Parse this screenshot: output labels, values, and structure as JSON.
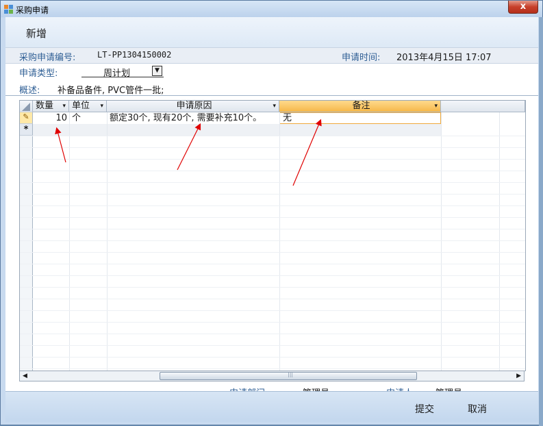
{
  "window": {
    "title": "采购申请",
    "close_label": "x"
  },
  "header": {
    "title": "新增"
  },
  "info": {
    "number_label": "采购申请编号:",
    "number_value": "LT-PP1304150002",
    "time_label": "申请时间:",
    "time_value": "2013年4月15日 17:07"
  },
  "form": {
    "type_label": "申请类型:",
    "type_value": "周计划",
    "summary_label": "概述:",
    "summary_value": "补备品备件, PVC管件一批;"
  },
  "grid": {
    "columns": [
      {
        "label": "数量",
        "key": "qty"
      },
      {
        "label": "单位",
        "key": "unit"
      },
      {
        "label": "申请原因",
        "key": "reason"
      },
      {
        "label": "备注",
        "key": "remark"
      }
    ],
    "rows": [
      {
        "qty": "10",
        "unit": "个",
        "reason": "额定30个, 现有20个, 需要补充10个。",
        "remark": "无"
      }
    ],
    "edit_marker": "✎",
    "new_marker": "*"
  },
  "footer": {
    "dept_label": "申请部门:",
    "dept_value": "管理员",
    "applicant_label": "申请人:",
    "applicant_value": "管理员"
  },
  "actions": {
    "submit_label": "提交",
    "cancel_label": "取消"
  },
  "colors": {
    "accent_label": "#2f5f95",
    "active_header": "#f5b84a",
    "annotation_arrow": "#e00000"
  }
}
